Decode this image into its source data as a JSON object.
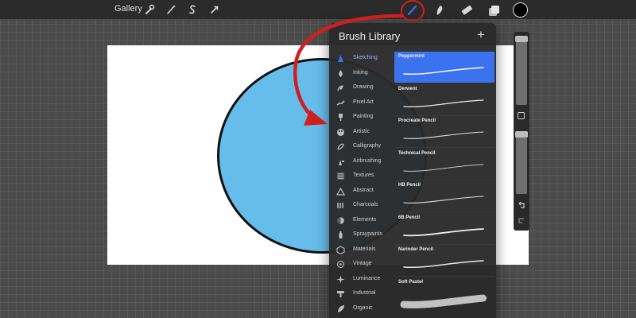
{
  "app": {
    "gallery_label": "Gallery",
    "top_left_tools": [
      "wrench-icon",
      "magic-wand-icon",
      "selection-icon",
      "transform-arrow-icon"
    ],
    "top_right_tools": [
      "brush-icon",
      "smudge-icon",
      "eraser-icon",
      "layers-icon",
      "color-swatch"
    ],
    "active_color": "#000000",
    "brush_tool_active_color": "#3a72f0",
    "highlight_color": "#d01f1f"
  },
  "canvas": {
    "background": "#ffffff",
    "shape_fill": "#66bcea",
    "shape_stroke": "#111111"
  },
  "brush_library": {
    "title": "Brush Library",
    "add_label": "+",
    "sets": [
      {
        "label": "Sketching",
        "icon": "sketching-icon",
        "active": true
      },
      {
        "label": "Inking",
        "icon": "ink-drop-icon"
      },
      {
        "label": "Drawing",
        "icon": "drawing-icon"
      },
      {
        "label": "Pixel Art",
        "icon": "pixel-art-icon"
      },
      {
        "label": "Painting",
        "icon": "paint-brush-icon"
      },
      {
        "label": "Artistic",
        "icon": "palette-icon"
      },
      {
        "label": "Calligraphy",
        "icon": "calligraphy-icon"
      },
      {
        "label": "Airbrushing",
        "icon": "airbrush-icon"
      },
      {
        "label": "Textures",
        "icon": "texture-icon"
      },
      {
        "label": "Abstract",
        "icon": "abstract-icon"
      },
      {
        "label": "Charcoals",
        "icon": "charcoal-icon"
      },
      {
        "label": "Elements",
        "icon": "elements-icon"
      },
      {
        "label": "Spraypaints",
        "icon": "spraypaint-icon"
      },
      {
        "label": "Materials",
        "icon": "materials-icon"
      },
      {
        "label": "Vintage",
        "icon": "vintage-icon"
      },
      {
        "label": "Luminance",
        "icon": "luminance-icon"
      },
      {
        "label": "Industrial",
        "icon": "industrial-icon"
      },
      {
        "label": "Organic",
        "icon": "organic-icon"
      }
    ],
    "brushes": [
      {
        "name": "Peppermint",
        "selected": true
      },
      {
        "name": "Derwent"
      },
      {
        "name": "Procreate Pencil"
      },
      {
        "name": "Technical Pencil"
      },
      {
        "name": "HB Pencil"
      },
      {
        "name": "6B Pencil"
      },
      {
        "name": "Narinder Pencil"
      },
      {
        "name": "Soft Pastel"
      }
    ]
  },
  "sidebar": {
    "undo_icon": "undo-icon",
    "redo_icon": "redo-icon",
    "modify_icon": "square-modify-icon"
  }
}
